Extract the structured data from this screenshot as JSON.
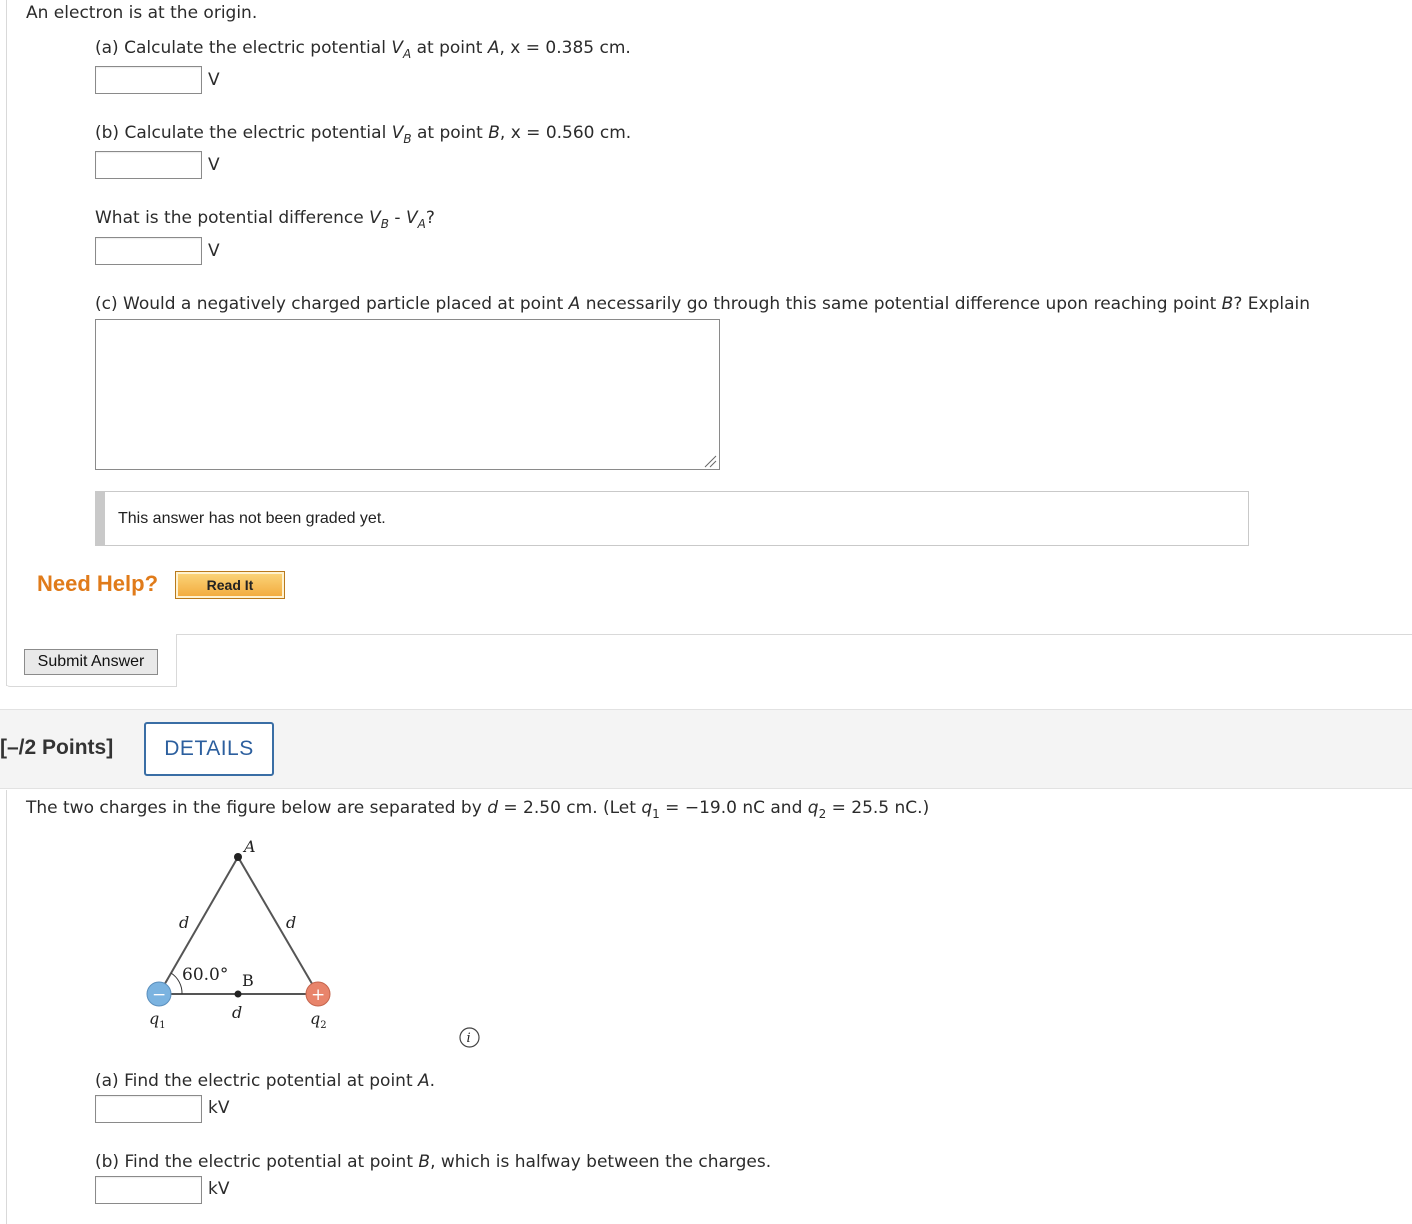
{
  "problem1": {
    "intro": "An electron is at the origin.",
    "part_a": {
      "prefix": "(a) Calculate the electric potential ",
      "var": "V",
      "sub": "A",
      "mid": " at point ",
      "point": "A",
      "rest": ", x = 0.385 cm.",
      "unit": "V"
    },
    "part_b": {
      "prefix": "(b) Calculate the electric potential ",
      "var": "V",
      "sub": "B",
      "mid": " at point ",
      "point": "B",
      "rest": ", x = 0.560 cm.",
      "unit": "V"
    },
    "diff": {
      "prefix": "What is the potential difference ",
      "var1": "V",
      "sub1": "B",
      "minus": " - ",
      "var2": "V",
      "sub2": "A",
      "q": "?",
      "unit": "V"
    },
    "part_c": {
      "prefix": "(c) Would a negatively charged particle placed at point ",
      "pA": "A",
      "mid": " necessarily go through this same potential difference upon reaching point ",
      "pB": "B",
      "end": "? Explain"
    },
    "graded_msg": "This answer has not been graded yet.",
    "need_help": "Need Help?",
    "read_it": "Read It",
    "submit": "Submit Answer"
  },
  "problem2": {
    "points": "[–/2 Points]",
    "details": "DETAILS",
    "statement": {
      "t1": "The two charges in the figure below are separated by ",
      "d": "d",
      "t2": " = 2.50 cm. (Let ",
      "q1": "q",
      "q1sub": "1",
      "t3": " = −19.0 nC and ",
      "q2": "q",
      "q2sub": "2",
      "t4": " = 25.5 nC.)"
    },
    "figure": {
      "A": "A",
      "B": "B",
      "d": "d",
      "angle": "60.0°",
      "q1": "q",
      "q1sub": "1",
      "q2": "q",
      "q2sub": "2",
      "plus": "+",
      "minus": "−",
      "info": "i"
    },
    "part_a": {
      "prefix": "(a) Find the electric potential at point ",
      "point": "A",
      "end": ".",
      "unit": "kV"
    },
    "part_b": {
      "prefix": "(b) Find the electric potential at point ",
      "point": "B",
      "end": ", which is halfway between the charges.",
      "unit": "kV"
    }
  },
  "colors": {
    "accent": "#e07b1a",
    "details_blue": "#2c5f9e",
    "neg_charge": "#7bb3e0",
    "pos_charge": "#e8846b"
  }
}
